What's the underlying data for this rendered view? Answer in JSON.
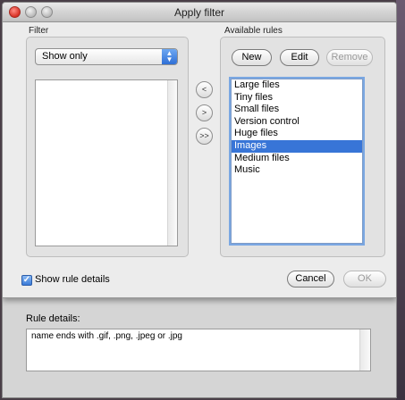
{
  "window": {
    "title": "Apply filter"
  },
  "filter": {
    "group_label": "Filter",
    "mode_selected": "Show only",
    "items": []
  },
  "transfer": {
    "add_label": "<",
    "remove_label": ">",
    "remove_all_label": ">>"
  },
  "available": {
    "group_label": "Available rules",
    "new_label": "New",
    "edit_label": "Edit",
    "remove_label": "Remove",
    "rules": [
      "Large files",
      "Tiny files",
      "Small files",
      "Version control",
      "Huge files",
      "Images",
      "Medium files",
      "Music"
    ],
    "selected_index": 5
  },
  "options": {
    "show_details_label": "Show rule details",
    "show_details_checked": true
  },
  "actions": {
    "cancel_label": "Cancel",
    "ok_label": "OK"
  },
  "details": {
    "label": "Rule details:",
    "text": "name ends with .gif, .png, .jpeg or .jpg"
  },
  "colors": {
    "selection": "#3875d7",
    "focus_ring": "#7aa7e2",
    "close_button": "#d83024"
  }
}
